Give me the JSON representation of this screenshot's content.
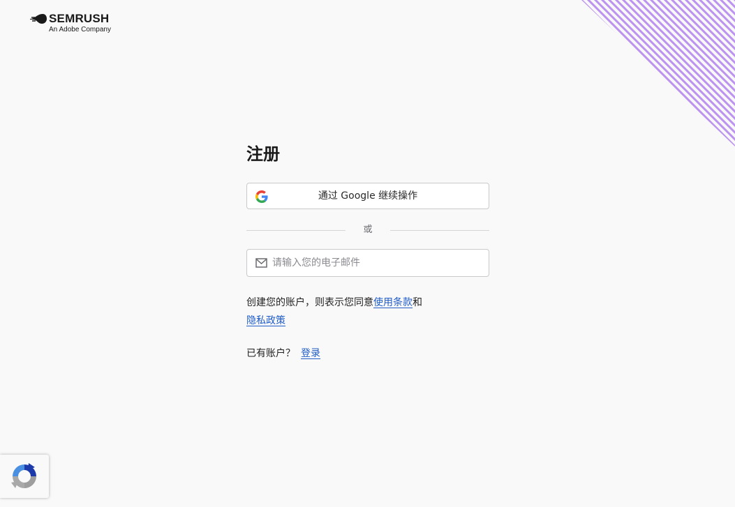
{
  "brand": {
    "name": "SEMRUSH",
    "tagline": "An Adobe Company",
    "accent_color": "#9b5de5"
  },
  "signup": {
    "title": "注册",
    "google_button_label": "通过 Google 继续操作",
    "divider_label": "或",
    "email_placeholder": "请输入您的电子邮件",
    "terms_prefix": "创建您的账户，则表示您同意",
    "terms_link": "使用条款",
    "terms_conjunction": "和",
    "privacy_link": "隐私政策",
    "login_prompt": "已有账户？",
    "login_link": "登录",
    "link_color": "#1f5cc8"
  },
  "icons": {
    "logo": "semrush-logo-icon",
    "google": "google-icon",
    "email": "mail-icon",
    "captcha": "recaptcha-icon"
  }
}
